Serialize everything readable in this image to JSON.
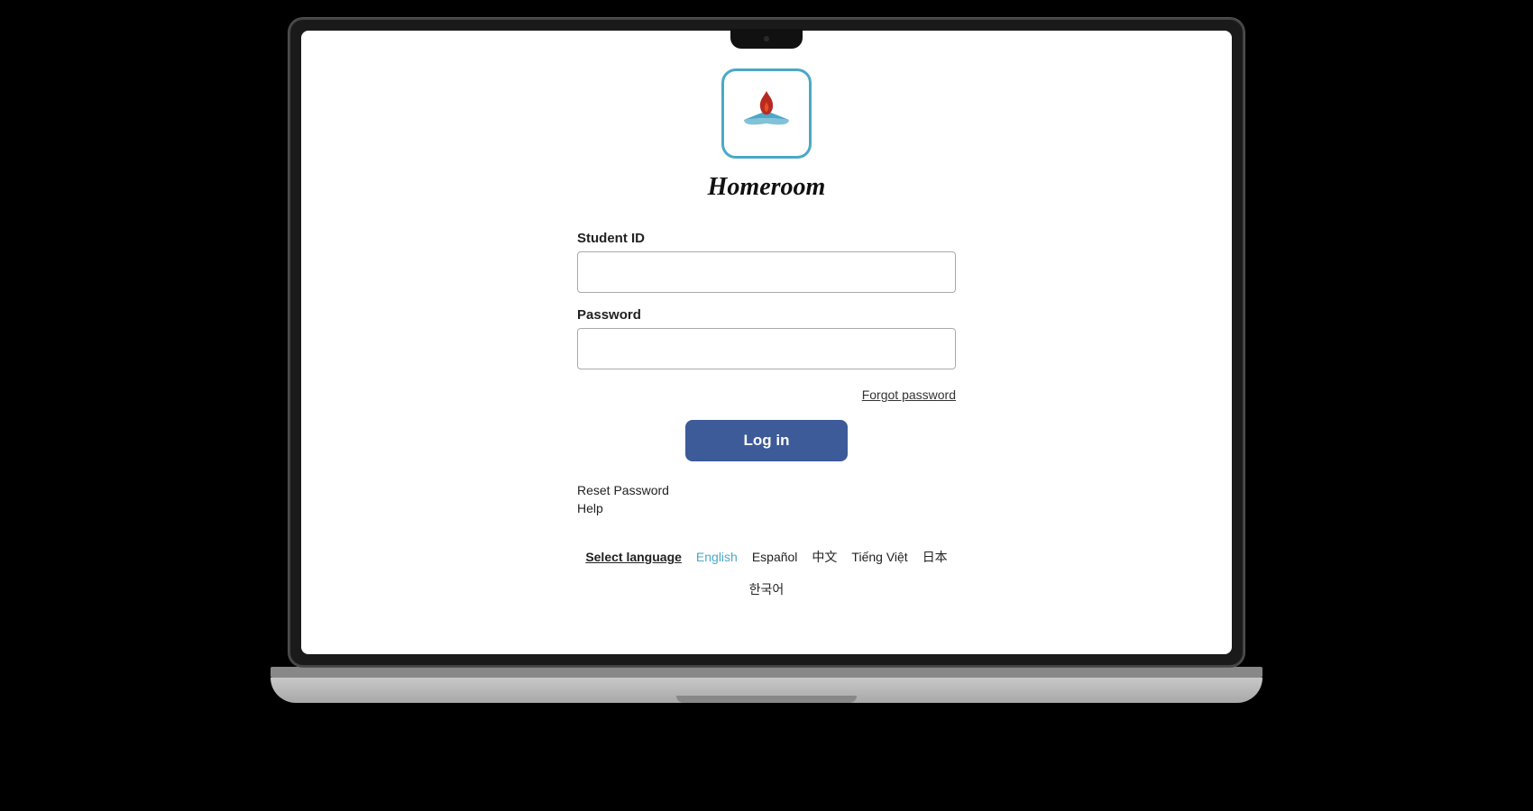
{
  "app": {
    "title": "Homeroom"
  },
  "form": {
    "student_id_label": "Student ID",
    "student_id_placeholder": "",
    "password_label": "Password",
    "password_placeholder": "",
    "forgot_password_label": "Forgot password",
    "login_button_label": "Log in",
    "reset_password_label": "Reset Password",
    "help_label": "Help"
  },
  "language": {
    "select_label": "Select language",
    "options": [
      {
        "code": "en",
        "label": "English",
        "active": true
      },
      {
        "code": "es",
        "label": "Español",
        "active": false
      },
      {
        "code": "zh",
        "label": "中文",
        "active": false
      },
      {
        "code": "vi",
        "label": "Tiếng Việt",
        "active": false
      },
      {
        "code": "ja",
        "label": "日本",
        "active": false
      },
      {
        "code": "ko",
        "label": "한국어",
        "active": false
      }
    ]
  },
  "colors": {
    "logo_border": "#4ba8c8",
    "logo_flame": "#b82a20",
    "logo_wings": "#4ba8c8",
    "button_bg": "#3d5a99",
    "active_lang": "#4ba8c8"
  }
}
